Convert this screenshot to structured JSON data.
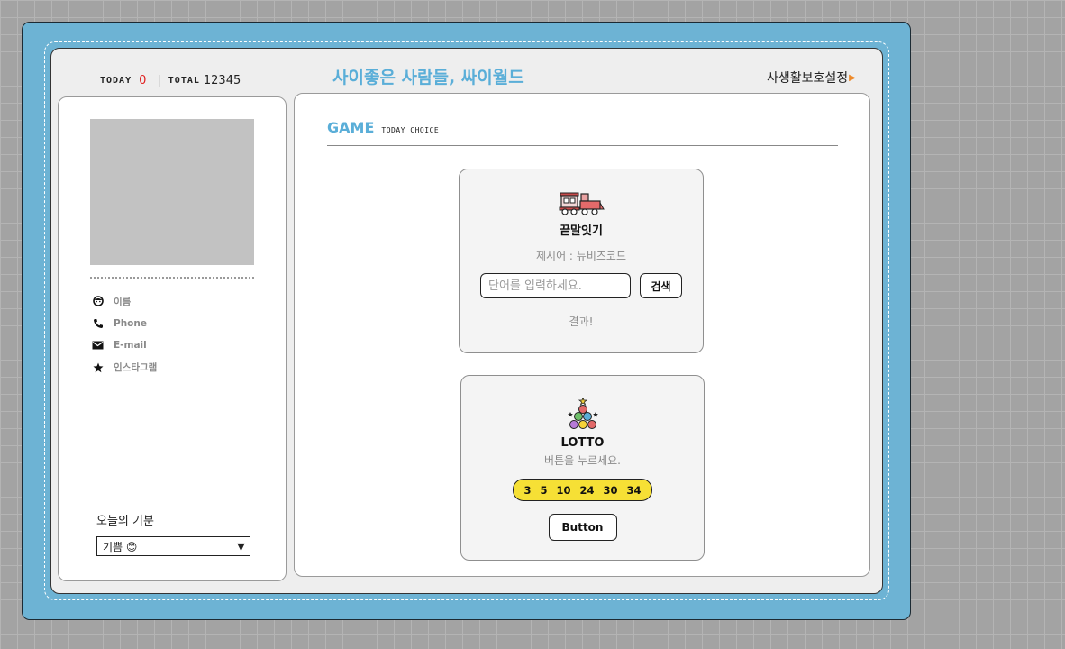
{
  "header": {
    "today_label": "TODAY",
    "today_count": "0",
    "separator": "|",
    "total_label": "TOTAL",
    "total_count": "12345",
    "site_title": "사이좋은 사람들, 싸이월드",
    "privacy_label": "사생활보호설정"
  },
  "profile": {
    "items": [
      {
        "icon": "smiley-icon",
        "label": "이름"
      },
      {
        "icon": "phone-icon",
        "label": "Phone"
      },
      {
        "icon": "envelope-icon",
        "label": "E-mail"
      },
      {
        "icon": "star-icon",
        "label": "인스타그램"
      }
    ],
    "mood_label": "오늘의 기분",
    "mood_value": "기쁨 😊"
  },
  "game": {
    "heading": "GAME",
    "subheading": "TODAY CHOICE",
    "word_chain": {
      "title": "끝말잇기",
      "hint": "제시어 : 뉴비즈코드",
      "input_placeholder": "단어를 입력하세요.",
      "search_label": "검색",
      "result": "결과!"
    },
    "lotto": {
      "title": "LOTTO",
      "hint": "버튼을 누르세요.",
      "numbers": [
        "3",
        "5",
        "10",
        "24",
        "30",
        "34"
      ],
      "button_label": "Button"
    }
  },
  "colors": {
    "frame_blue": "#6db3d4",
    "title_blue": "#5aaed8",
    "today_red": "#e02020",
    "lotto_yellow": "#f6e035"
  }
}
